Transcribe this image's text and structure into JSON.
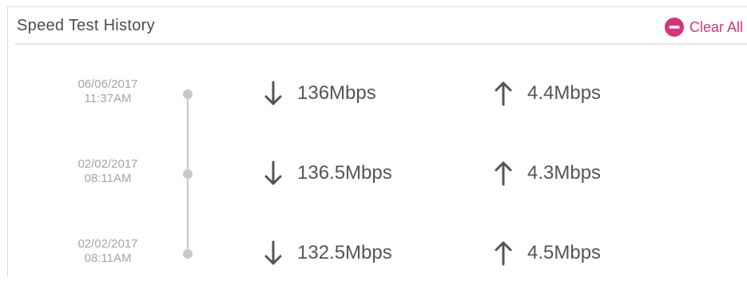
{
  "header": {
    "title": "Speed Test History",
    "clear_all_label": "Clear All",
    "clear_icon": "minus-circle-icon"
  },
  "colors": {
    "accent": "#d4357a",
    "text": "#555555",
    "muted": "#a5a5a5",
    "timeline": "#c8c8c8"
  },
  "history": [
    {
      "date": "06/06/2017",
      "time": "11:37AM",
      "download_icon": "arrow-down-icon",
      "download": "136Mbps",
      "upload_icon": "arrow-up-icon",
      "upload": "4.4Mbps"
    },
    {
      "date": "02/02/2017",
      "time": "08:11AM",
      "download_icon": "arrow-down-icon",
      "download": "136.5Mbps",
      "upload_icon": "arrow-up-icon",
      "upload": "4.3Mbps"
    },
    {
      "date": "02/02/2017",
      "time": "08:11AM",
      "download_icon": "arrow-down-icon",
      "download": "132.5Mbps",
      "upload_icon": "arrow-up-icon",
      "upload": "4.5Mbps"
    }
  ]
}
